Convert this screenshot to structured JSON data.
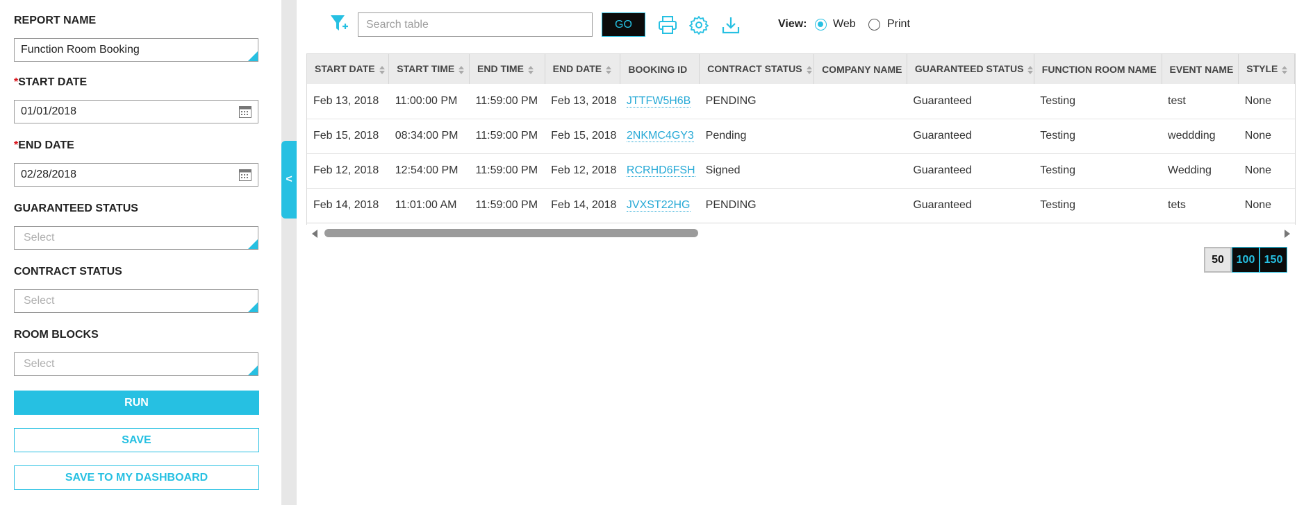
{
  "sidebar": {
    "report_name_label": "REPORT NAME",
    "report_name_value": "Function Room Booking",
    "start_date_label": "START DATE",
    "start_date_value": "01/01/2018",
    "end_date_label": "END DATE",
    "end_date_value": "02/28/2018",
    "required_mark": "*",
    "guaranteed_status_label": "GUARANTEED STATUS",
    "guaranteed_status_value": "Select",
    "contract_status_label": "CONTRACT STATUS",
    "contract_status_value": "Select",
    "room_blocks_label": "ROOM BLOCKS",
    "room_blocks_value": "Select",
    "run_label": "RUN",
    "save_label": "SAVE",
    "save_dashboard_label": "SAVE TO MY DASHBOARD",
    "collapse_glyph": "<"
  },
  "toolbar": {
    "search_placeholder": "Search table",
    "go_label": "GO",
    "view_label": "View:",
    "view_options": [
      "Web",
      "Print"
    ],
    "view_selected": "Web"
  },
  "table": {
    "columns": [
      "START DATE",
      "START TIME",
      "END TIME",
      "END DATE",
      "BOOKING ID",
      "CONTRACT STATUS",
      "COMPANY NAME",
      "GUARANTEED STATUS",
      "FUNCTION ROOM NAME",
      "EVENT NAME",
      "STYLE"
    ],
    "rows": [
      [
        "Feb 13, 2018",
        "11:00:00 PM",
        "11:59:00 PM",
        "Feb 13, 2018",
        "JTTFW5H6B",
        "PENDING",
        "",
        "Guaranteed",
        "Testing",
        "test",
        "None"
      ],
      [
        "Feb 15, 2018",
        "08:34:00 PM",
        "11:59:00 PM",
        "Feb 15, 2018",
        "2NKMC4GY3",
        "Pending",
        "",
        "Guaranteed",
        "Testing",
        "weddding",
        "None"
      ],
      [
        "Feb 12, 2018",
        "12:54:00 PM",
        "11:59:00 PM",
        "Feb 12, 2018",
        "RCRHD6FSH",
        "Signed",
        "",
        "Guaranteed",
        "Testing",
        "Wedding",
        "None"
      ],
      [
        "Feb 14, 2018",
        "11:01:00 AM",
        "11:59:00 PM",
        "Feb 14, 2018",
        "JVXST22HG",
        "PENDING",
        "",
        "Guaranteed",
        "Testing",
        "tets",
        "None"
      ]
    ]
  },
  "pagination": {
    "page_sizes": [
      "50",
      "100",
      "150"
    ],
    "selected": "50"
  },
  "colors": {
    "accent": "#26c0e2",
    "link": "#26a9d6",
    "header_bg": "#ebebeb",
    "required": "#d9141c"
  },
  "icons": [
    "filter-add-icon",
    "print-icon",
    "settings-gear-icon",
    "download-icon",
    "calendar-icon"
  ]
}
